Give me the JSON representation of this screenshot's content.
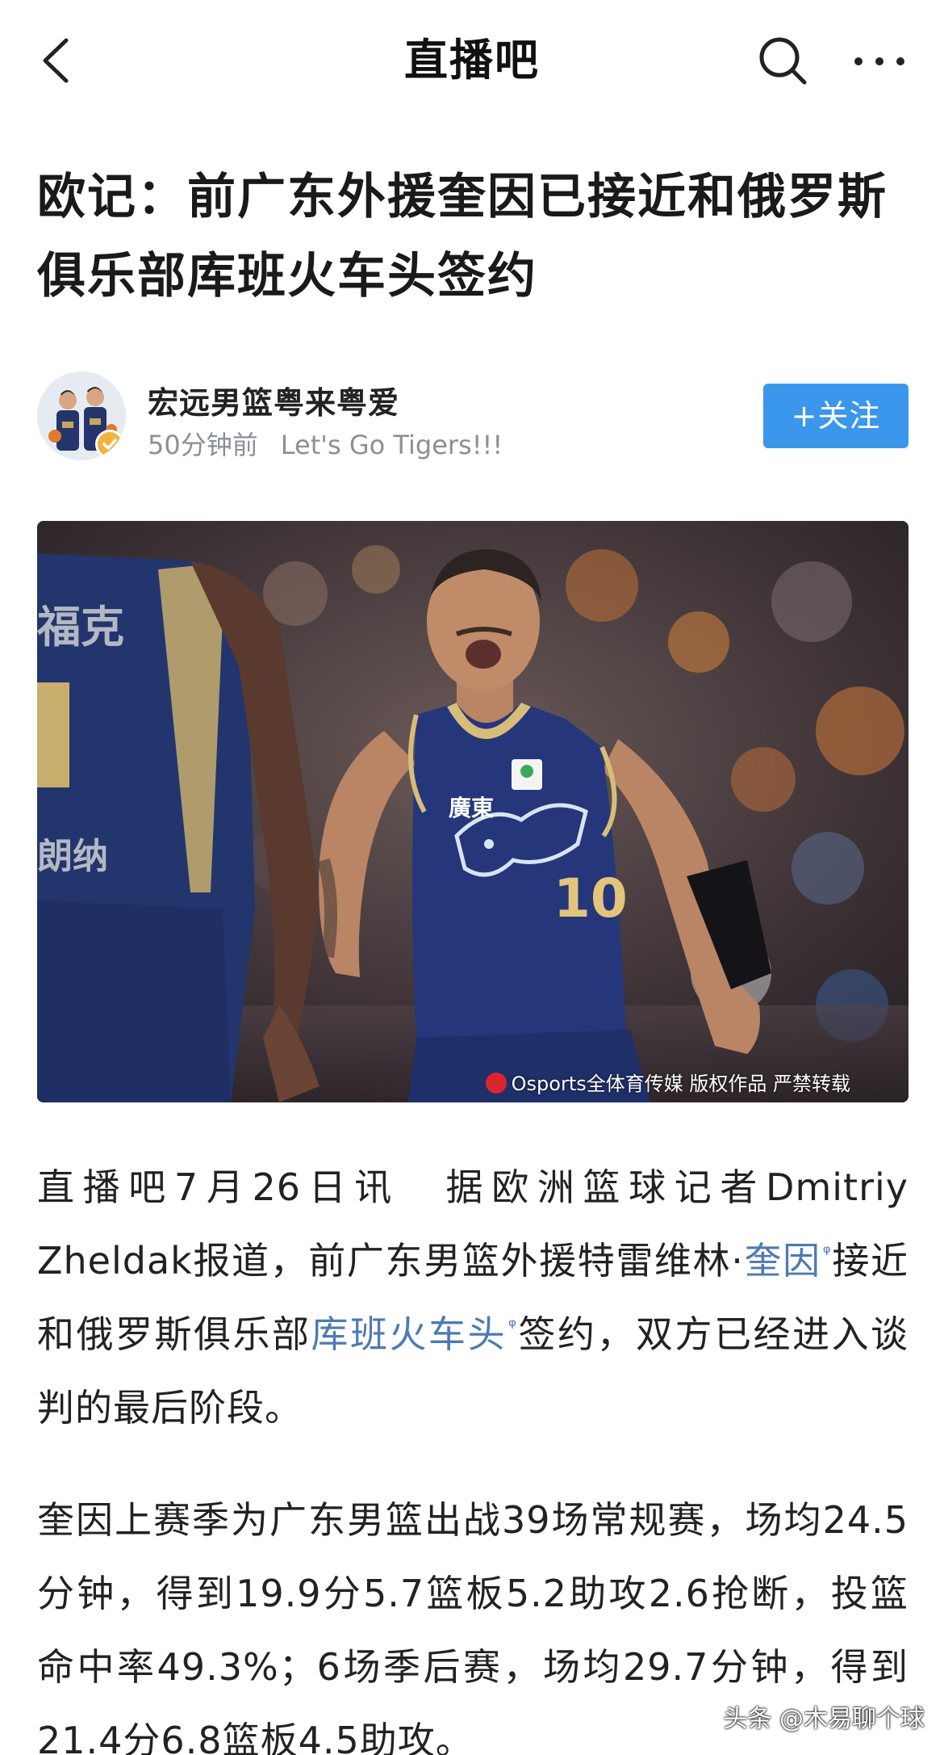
{
  "nav": {
    "title": "直播吧",
    "icons": [
      "back-arrow-icon",
      "search-icon",
      "more-icon"
    ]
  },
  "headline": "欧记：前广东外援奎因已接近和俄罗斯俱乐部库班火车头签约",
  "author": {
    "name": "宏远男篮粤来粤爱",
    "time": "50分钟前",
    "slogan": "Let's Go Tigers!!!",
    "follow_label": "+关注"
  },
  "photo": {
    "credit": "Osports全体育传媒  版权作品 严禁转载",
    "jersey_number": "10",
    "jersey_team": "廣東"
  },
  "article": {
    "p1_part1": "直播吧7月26日讯　据欧洲篮球记者Dmitriy Zheldak报道，前广东男篮外援特雷维林·",
    "p1_link1": "奎因",
    "p1_part2": "接近和俄罗斯俱乐部",
    "p1_link2": "库班火车头",
    "p1_part3": "签约，双方已经进入谈判的最后阶段。",
    "p2": "奎因上赛季为广东男篮出战39场常规赛，场均24.5分钟，得到19.9分5.7篮板5.2助攻2.6抢断，投篮命中率49.3%；6场季后赛，场均29.7分钟，得到21.4分6.8篮板4.5助攻。"
  },
  "watermark": "头条 @木易聊个球",
  "colors": {
    "follow_button": "#3a97ec",
    "link": "#4d7ab3",
    "meta_text": "#8a8f99"
  }
}
